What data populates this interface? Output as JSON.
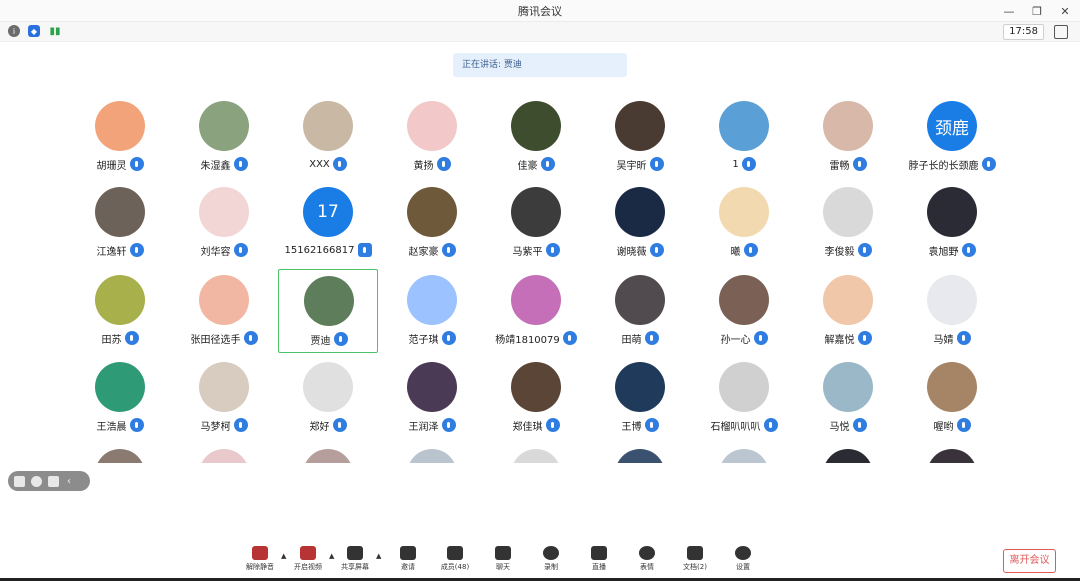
{
  "window": {
    "title": "腾讯会议",
    "controls": [
      "minimize-icon",
      "restore-icon",
      "close-icon"
    ]
  },
  "status": {
    "time": "17:58"
  },
  "speaking": {
    "text": "正在讲话: 贾迪"
  },
  "participants": [
    {
      "name": "胡珊灵",
      "color": "#f3a37a",
      "mic": "mic"
    },
    {
      "name": "朱湿鑫",
      "color": "#8aa37e",
      "mic": "mic"
    },
    {
      "name": "XXX",
      "color": "#c9b8a4",
      "mic": "mic"
    },
    {
      "name": "黄扬",
      "color": "#f2c8c8",
      "mic": "mic"
    },
    {
      "name": "佳豪",
      "color": "#3d4d2e",
      "mic": "mic"
    },
    {
      "name": "吴宇昕",
      "color": "#4a3b32",
      "mic": "mic"
    },
    {
      "name": "1",
      "color": "#5aa0d6",
      "mic": "mic"
    },
    {
      "name": "雷畅",
      "color": "#d8b8a8",
      "mic": "mic"
    },
    {
      "name": "脖子长的长颈鹿",
      "color": "#1a7de5",
      "mic": "mic",
      "initials": "颈鹿"
    },
    {
      "name": "江逸轩",
      "color": "#6d6259",
      "mic": "mic"
    },
    {
      "name": "刘华容",
      "color": "#f2d6d6",
      "mic": "mic"
    },
    {
      "name": "15162166817",
      "color": "#1a7de5",
      "mic": "phone",
      "initials": "17"
    },
    {
      "name": "赵家豪",
      "color": "#6e5a3a",
      "mic": "mic"
    },
    {
      "name": "马紫平",
      "color": "#3c3c3c",
      "mic": "mic"
    },
    {
      "name": "谢晓薇",
      "color": "#1b2a44",
      "mic": "mic"
    },
    {
      "name": "曦",
      "color": "#f3d9b0",
      "mic": "mic"
    },
    {
      "name": "李俊毅",
      "color": "#d9d9d9",
      "mic": "mic"
    },
    {
      "name": "袁旭野",
      "color": "#2b2b35",
      "mic": "mic"
    },
    {
      "name": "田苏",
      "color": "#a7b04a",
      "mic": "mic"
    },
    {
      "name": "张田径选手",
      "color": "#f2b7a3",
      "mic": "mic"
    },
    {
      "name": "贾迪",
      "color": "#5e7d5a",
      "mic": "mic",
      "active": true
    },
    {
      "name": "范子琪",
      "color": "#9cc2ff",
      "mic": "mic"
    },
    {
      "name": "杨靖1810079",
      "color": "#c46fb8",
      "mic": "mic"
    },
    {
      "name": "田萌",
      "color": "#514a4f",
      "mic": "mic"
    },
    {
      "name": "孙一心",
      "color": "#7b6155",
      "mic": "mic"
    },
    {
      "name": "解嘉悦",
      "color": "#f0c7a9",
      "mic": "mic"
    },
    {
      "name": "马婧",
      "color": "#e8e8ef",
      "mic": "mic"
    },
    {
      "name": "王浩晨",
      "color": "#2f9a76",
      "mic": "mic"
    },
    {
      "name": "马梦柯",
      "color": "#d8cbbf",
      "mic": "mic"
    },
    {
      "name": "郑好",
      "color": "#e0e0e0",
      "mic": "mic"
    },
    {
      "name": "王润泽",
      "color": "#4b3a55",
      "mic": "mic"
    },
    {
      "name": "郑佳琪",
      "color": "#5b4537",
      "mic": "mic"
    },
    {
      "name": "王博",
      "color": "#1f3a5a",
      "mic": "mic"
    },
    {
      "name": "石榴叭叭叭",
      "color": "#d0d0d0",
      "mic": "mic"
    },
    {
      "name": "马悦",
      "color": "#9ab8c8",
      "mic": "mic"
    },
    {
      "name": "喔哟",
      "color": "#a68466",
      "mic": "mic"
    }
  ],
  "partial_row_colors": [
    "#8a7a70",
    "#e9c9cc",
    "#b69e9c",
    "#b9c4cf",
    "#d9d9d9",
    "#3b5170",
    "#bcc6d1",
    "#2b2b33",
    "#39323a"
  ],
  "toolbar": [
    {
      "label": "解除静音",
      "icon": "mic-muted-icon",
      "caret": true
    },
    {
      "label": "开启视频",
      "icon": "video-off-icon",
      "caret": true
    },
    {
      "label": "共享屏幕",
      "icon": "share-screen-icon",
      "caret": true
    },
    {
      "label": "邀请",
      "icon": "invite-icon"
    },
    {
      "label": "成员(48)",
      "icon": "members-icon"
    },
    {
      "label": "聊天",
      "icon": "chat-icon"
    },
    {
      "label": "录制",
      "icon": "record-icon"
    },
    {
      "label": "直播",
      "icon": "live-icon"
    },
    {
      "label": "表情",
      "icon": "emoji-icon"
    },
    {
      "label": "文档(2)",
      "icon": "document-icon"
    },
    {
      "label": "设置",
      "icon": "settings-icon"
    }
  ],
  "leave": {
    "label": "离开会议",
    "color": "#e15a5a"
  },
  "colors": {
    "accent": "#2f7de1",
    "active_border": "#4cc26b"
  }
}
